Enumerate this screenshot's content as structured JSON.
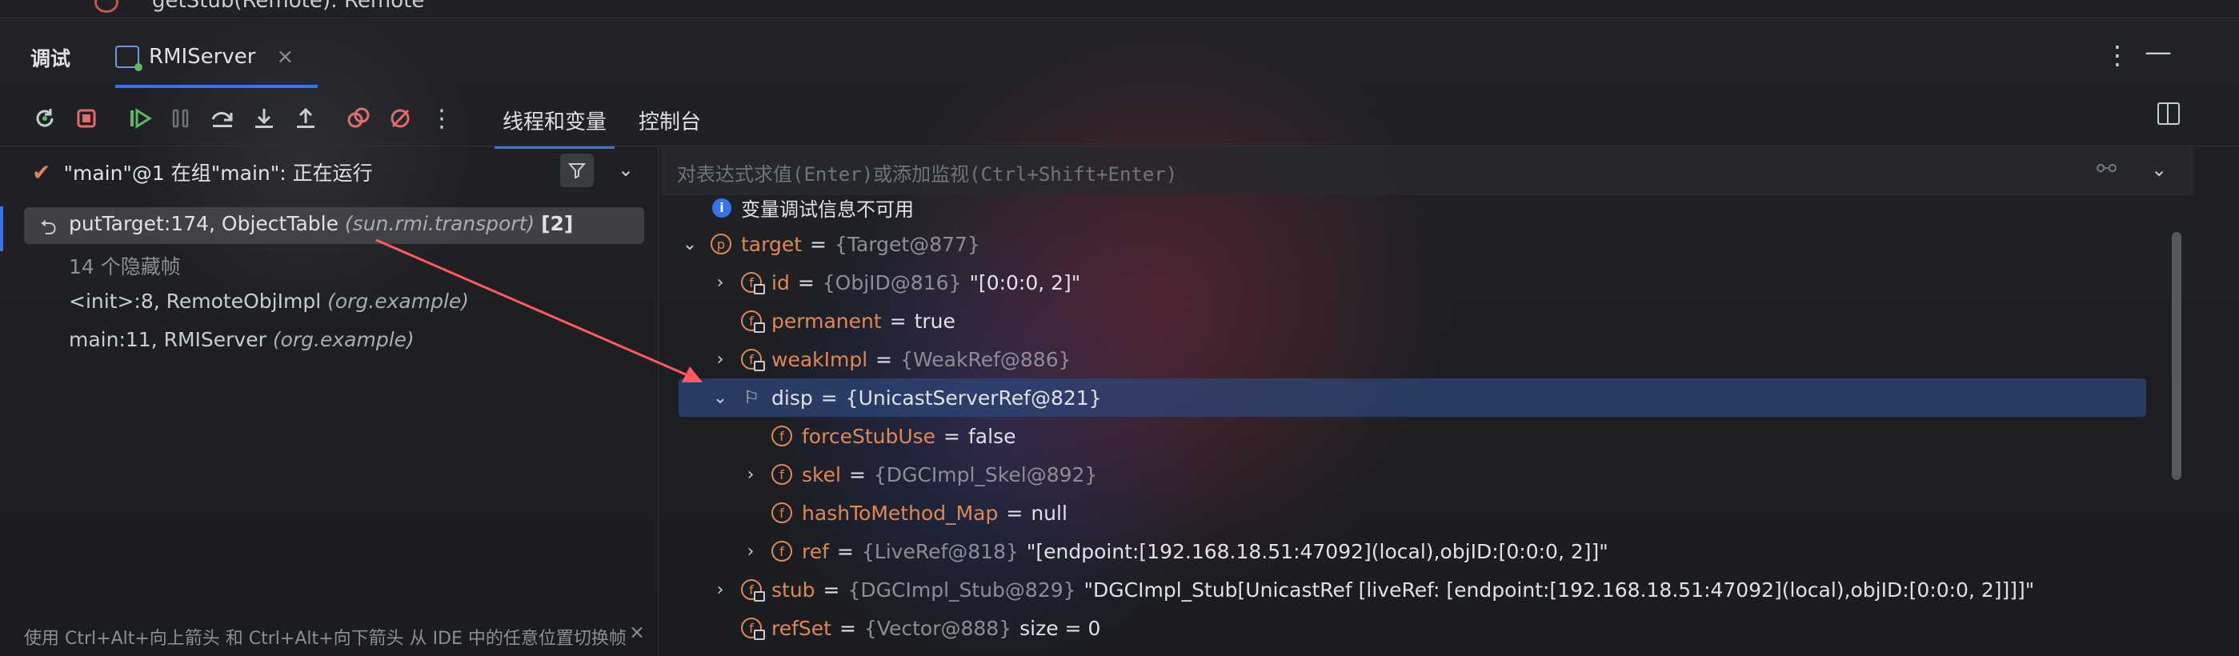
{
  "top_fragment": "getStub(Remote): Remote",
  "panel_title": "调试",
  "run_config_tab": {
    "label": "RMIServer",
    "close": "×"
  },
  "header_actions": {
    "more": "⋮",
    "minimize": "—"
  },
  "subtabs": {
    "threads_vars": "线程和变量",
    "console": "控制台"
  },
  "thread_selector": {
    "text": "\"main\"@1 在组\"main\": 正在运行"
  },
  "frames": [
    {
      "method": "putTarget:174, ObjectTable",
      "location": "(sun.rmi.transport)",
      "count": "[2]"
    },
    {
      "text": "14 个隐藏帧"
    },
    {
      "method": "<init>:8, RemoteObjImpl",
      "location": "(org.example)"
    },
    {
      "method": "main:11, RMIServer",
      "location": "(org.example)"
    }
  ],
  "hint": {
    "text": "使用 Ctrl+Alt+向上箭头 和 Ctrl+Alt+向下箭头 从 IDE 中的任意位置切换帧",
    "close": "×"
  },
  "expression": {
    "placeholder": "对表达式求值(Enter)或添加监视(Ctrl+Shift+Enter)"
  },
  "info": {
    "icon": "i",
    "text": "变量调试信息不可用"
  },
  "variables": [
    {
      "name": "target",
      "eq": "=",
      "type": "{Target@877}",
      "value": "",
      "icon": "p",
      "twisty": "⌄"
    },
    {
      "name": "id",
      "eq": "=",
      "type": "{ObjID@816}",
      "value": "\"[0:0:0, 2]\"",
      "icon": "f",
      "twisty": "›"
    },
    {
      "name": "permanent",
      "eq": "=",
      "type": "",
      "value": "true",
      "icon": "f",
      "twisty": ""
    },
    {
      "name": "weakImpl",
      "eq": "=",
      "type": "{WeakRef@886}",
      "value": "",
      "icon": "f",
      "twisty": "›"
    },
    {
      "name": "disp",
      "eq": "=",
      "type": "{UnicastServerRef@821}",
      "value": "",
      "icon": "flag",
      "twisty": "⌄"
    },
    {
      "name": "forceStubUse",
      "eq": "=",
      "type": "",
      "value": "false",
      "icon": "f",
      "twisty": ""
    },
    {
      "name": "skel",
      "eq": "=",
      "type": "{DGCImpl_Skel@892}",
      "value": "",
      "icon": "f",
      "twisty": "›"
    },
    {
      "name": "hashToMethod_Map",
      "eq": "=",
      "type": "",
      "value": "null",
      "icon": "f",
      "twisty": ""
    },
    {
      "name": "ref",
      "eq": "=",
      "type": "{LiveRef@818}",
      "value": "\"[endpoint:[192.168.18.51:47092](local),objID:[0:0:0, 2]]\"",
      "icon": "f",
      "twisty": "›"
    },
    {
      "name": "stub",
      "eq": "=",
      "type": "{DGCImpl_Stub@829}",
      "value": "\"DGCImpl_Stub[UnicastRef [liveRef: [endpoint:[192.168.18.51:47092](local),objID:[0:0:0, 2]]]]\"",
      "icon": "f",
      "twisty": "›"
    },
    {
      "name": "refSet",
      "eq": "=",
      "type": "{Vector@888}",
      "value": "size = 0",
      "icon": "f",
      "twisty": ""
    }
  ],
  "colors": {
    "accent": "#3574f0",
    "field": "#e08855",
    "annotation_arrow": "#ff5a5f"
  }
}
